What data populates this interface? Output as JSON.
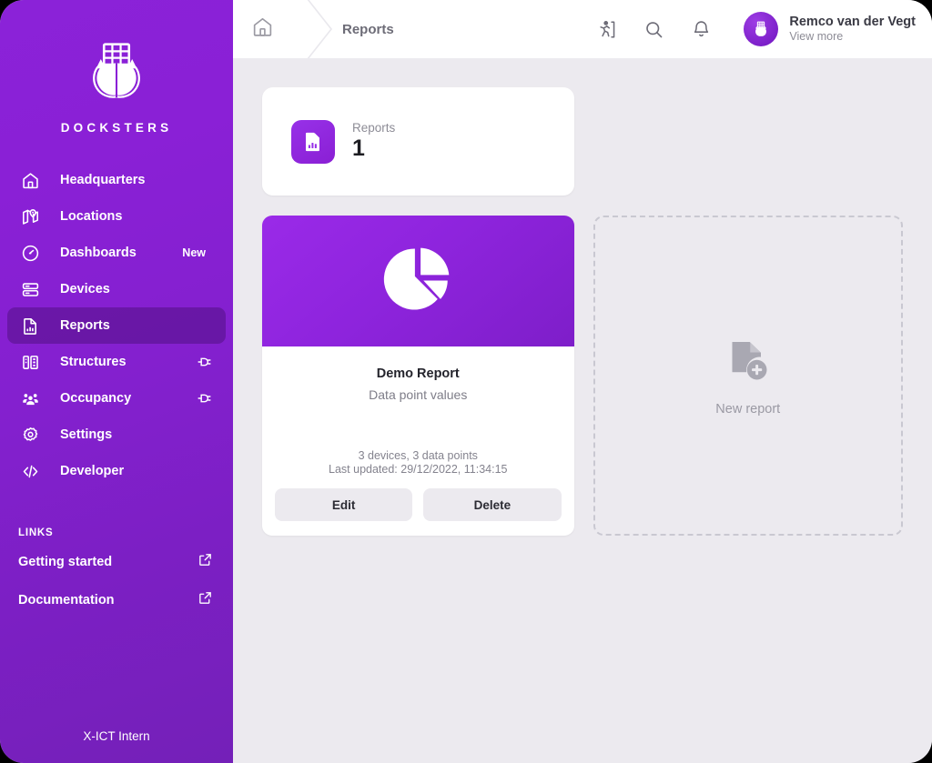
{
  "brand": {
    "name": "DOCKSTERS",
    "logo_icon": "docksters-anchor-logo",
    "accent": "#8a20d6"
  },
  "sidebar": {
    "items": [
      {
        "label": "Headquarters",
        "icon": "home-icon",
        "active": false
      },
      {
        "label": "Locations",
        "icon": "map-pin-icon",
        "active": false
      },
      {
        "label": "Dashboards",
        "icon": "gauge-icon",
        "active": false,
        "badge": "New"
      },
      {
        "label": "Devices",
        "icon": "server-stack-icon",
        "active": false
      },
      {
        "label": "Reports",
        "icon": "report-document-icon",
        "active": true
      },
      {
        "label": "Structures",
        "icon": "building-icon",
        "active": false,
        "plug": "plug-icon"
      },
      {
        "label": "Occupancy",
        "icon": "people-icon",
        "active": false,
        "plug": "plug-icon"
      },
      {
        "label": "Settings",
        "icon": "gear-icon",
        "active": false
      },
      {
        "label": "Developer",
        "icon": "code-brackets-icon",
        "active": false
      }
    ],
    "links_heading": "LINKS",
    "links": [
      {
        "label": "Getting started",
        "icon": "external-link-icon"
      },
      {
        "label": "Documentation",
        "icon": "external-link-icon"
      }
    ],
    "footer": "X-ICT Intern"
  },
  "header": {
    "home_icon": "home-icon",
    "breadcrumb": "Reports",
    "icons": [
      {
        "name": "emergency-exit-icon"
      },
      {
        "name": "search-icon"
      },
      {
        "name": "bell-icon"
      }
    ],
    "user": {
      "name": "Remco van der Vegt",
      "subtitle": "View more",
      "avatar_icon": "docksters-avatar"
    }
  },
  "stats": {
    "icon": "report-document-icon",
    "label": "Reports",
    "value": "1"
  },
  "report": {
    "hero_icon": "pie-chart-icon",
    "title": "Demo Report",
    "subtitle": "Data point values",
    "meta_counts": "3 devices, 3 data points",
    "meta_updated": "Last updated: 29/12/2022, 11:34:15",
    "edit_label": "Edit",
    "delete_label": "Delete"
  },
  "new_report": {
    "icon": "document-add-icon",
    "label": "New report"
  }
}
